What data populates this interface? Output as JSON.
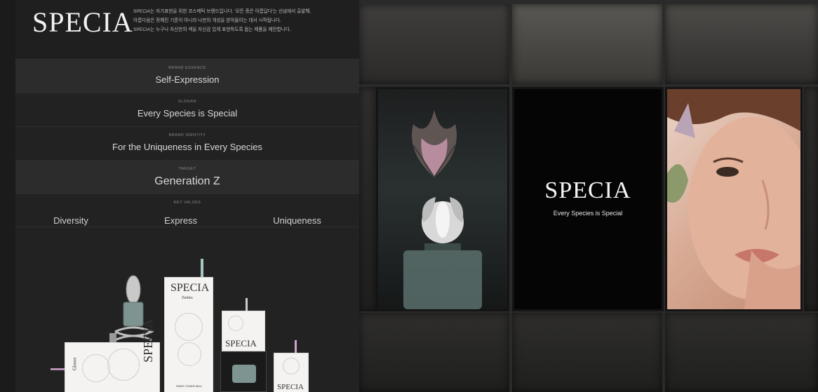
{
  "brand": {
    "logo": "SPECIA",
    "intro_lines": [
      "SPECIA는 자기표현을 위한 코스메틱 브랜드입니다. '모든 종은 아름답다'는 신념에서 출발해,",
      "아름다움은 정해진 기준이 아니라 나만의 개성을 받아들이는 데서 시작됩니다.",
      "SPECIA는 누구나 자신만의 색을 자신감 있게 표현하도록 돕는 제품을 제안합니다."
    ]
  },
  "essence": {
    "label": "BRAND ESSENCE",
    "value": "Self-Expression"
  },
  "slogan": {
    "label": "SLOGAN",
    "value": "Every Species is Special"
  },
  "identity": {
    "label": "BRAND IDENTITY",
    "value": "For the Uniqueness in Every Species"
  },
  "target": {
    "label": "TARGET",
    "value": "Generation Z"
  },
  "key_values": {
    "label": "KEY VALUES",
    "items": [
      "Diversity",
      "Express",
      "Uniqueness"
    ]
  },
  "products": {
    "box_tall_brand": "SPECIA",
    "box_tall_sub": "Zentra",
    "box_tall_small": "PARIS TONER 50ml",
    "box_mid_brand": "SPECIA",
    "box_low_brand": "SPECIA",
    "box_left_side": "Glowe",
    "box_left_brand": "SPECIA"
  },
  "display": {
    "logo": "SPECIA",
    "slogan": "Every Species is Special"
  },
  "colors": {
    "background": "#1b1b1b",
    "panel": "#222222",
    "highlight_row": "#2c2c2c",
    "text": "#d8d8d8"
  }
}
